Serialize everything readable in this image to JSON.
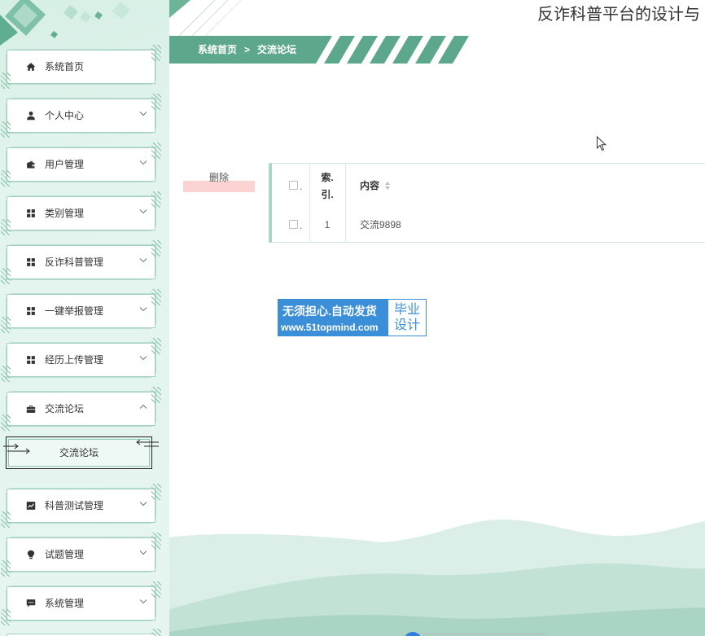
{
  "header": {
    "title": "反诈科普平台的设计与"
  },
  "breadcrumb": {
    "home": "系统首页",
    "separator": ">",
    "current": "交流论坛"
  },
  "sidebar": {
    "items": [
      {
        "label": "系统首页",
        "icon": "home-icon"
      },
      {
        "label": "个人中心",
        "icon": "user-icon",
        "chevron": "chevron-down-icon"
      },
      {
        "label": "用户管理",
        "icon": "wallet-icon",
        "chevron": "chevron-down-icon"
      },
      {
        "label": "类别管理",
        "icon": "grid-icon",
        "chevron": "chevron-down-icon"
      },
      {
        "label": "反诈科普管理",
        "icon": "grid-icon",
        "chevron": "chevron-down-icon"
      },
      {
        "label": "一键举报管理",
        "icon": "grid-icon",
        "chevron": "chevron-down-icon"
      },
      {
        "label": "经历上传管理",
        "icon": "grid-icon",
        "chevron": "chevron-down-icon"
      },
      {
        "label": "交流论坛",
        "icon": "briefcase-icon",
        "chevron": "chevron-up-icon",
        "expanded": true
      },
      {
        "label": "科普测试管理",
        "icon": "chart-icon",
        "chevron": "chevron-down-icon"
      },
      {
        "label": "试题管理",
        "icon": "bulb-icon",
        "chevron": "chevron-down-icon"
      },
      {
        "label": "系统管理",
        "icon": "chat-icon",
        "chevron": "chevron-down-icon"
      }
    ],
    "submenu": {
      "label": "交流论坛",
      "active": true
    }
  },
  "toolbar": {
    "delete_label": "删除"
  },
  "table": {
    "header": {
      "select_suffix": ".",
      "index_line1": "索.",
      "index_line2": "引.",
      "content": "内容",
      "content_sort_icon": "sort-icon"
    },
    "rows": [
      {
        "select_suffix": ".",
        "index": "1",
        "content": "交流9898"
      }
    ]
  },
  "watermark": {
    "line1": "无须担心.自动发货",
    "line2": "www.51topmind.com",
    "badge_line1": "毕业",
    "badge_line2": "设计"
  },
  "colors": {
    "accent": "#5da88c",
    "sidebar_bg": "#e2f3ed",
    "delete_accent": "#fbd3d3",
    "watermark_blue": "#3b8ed8",
    "table_left_border": "#a8d9c7"
  }
}
